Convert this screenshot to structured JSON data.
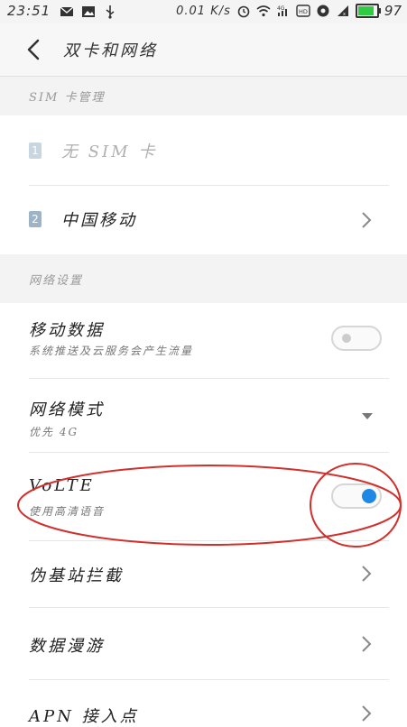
{
  "status_bar": {
    "time": "23:51",
    "speed_value": "0.01",
    "speed_unit": "K/s",
    "battery_level": "97",
    "battery_fill_percent": 97,
    "icons": [
      "mail-icon",
      "image-icon",
      "usb-icon",
      "alarm-icon",
      "wifi-icon",
      "4g-signal-icon",
      "hd-icon",
      "vpn-icon",
      "signal-icon",
      "battery-icon"
    ]
  },
  "header": {
    "title": "双卡和网络",
    "back_icon": "chevron-left-icon"
  },
  "sections": {
    "sim_label": "SIM 卡管理",
    "network_label": "网络设置"
  },
  "sim_rows": [
    {
      "badge": "1",
      "label": "无 SIM 卡",
      "badge_color": "#c8d6e0",
      "text_color": "#b0b0b0"
    },
    {
      "badge": "2",
      "label": "中国移动",
      "badge_color": "#9db3c6",
      "text_color": "#222222"
    }
  ],
  "settings": {
    "mobile_data": {
      "title": "移动数据",
      "subtitle": "系统推送及云服务会产生流量",
      "enabled": false
    },
    "network_mode": {
      "title": "网络模式",
      "subtitle": "优先 4G"
    },
    "volte": {
      "title": "VoLTE",
      "subtitle": "使用高清语音",
      "enabled": true
    },
    "fake_station": {
      "title": "伪基站拦截"
    },
    "roaming": {
      "title": "数据漫游"
    },
    "apn": {
      "title": "APN 接入点"
    }
  },
  "colors": {
    "accent": "#1e88e5",
    "annotation": "#d0312d"
  }
}
